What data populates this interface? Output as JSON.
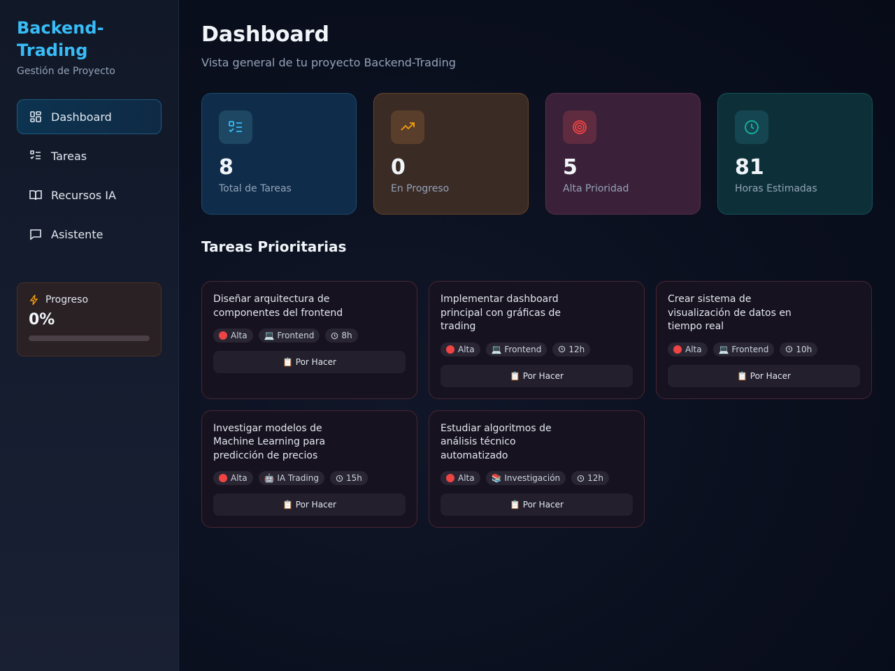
{
  "brand": {
    "title": "Backend-Trading",
    "subtitle": "Gestión de Proyecto"
  },
  "sidebar": {
    "items": [
      {
        "label": "Dashboard",
        "icon": "dashboard-icon",
        "active": true
      },
      {
        "label": "Tareas",
        "icon": "list-check-icon"
      },
      {
        "label": "Recursos IA",
        "icon": "book-icon"
      },
      {
        "label": "Asistente",
        "icon": "chat-icon"
      }
    ],
    "progress": {
      "label": "Progreso",
      "value": "0%",
      "fraction": 0,
      "icon": "bolt-icon"
    }
  },
  "header": {
    "title": "Dashboard",
    "subtitle": "Vista general de tu proyecto Backend-Trading"
  },
  "stats": [
    {
      "value": "8",
      "label": "Total de Tareas",
      "icon": "list-check-icon",
      "color": "#38bdf8"
    },
    {
      "value": "0",
      "label": "En Progreso",
      "icon": "trending-up-icon",
      "color": "#f59e0b"
    },
    {
      "value": "5",
      "label": "Alta Prioridad",
      "icon": "target-icon",
      "color": "#ef4444"
    },
    {
      "value": "81",
      "label": "Horas Estimadas",
      "icon": "clock-icon",
      "color": "#14b8a6"
    }
  ],
  "section_title": "Tareas Prioritarias",
  "tasks": [
    {
      "title": "Diseñar arquitectura de componentes del frontend",
      "priority": "Alta",
      "category": "💻 Frontend",
      "hours": "8h",
      "status": "📋 Por Hacer"
    },
    {
      "title": "Implementar dashboard principal con gráficas de trading",
      "priority": "Alta",
      "category": "💻 Frontend",
      "hours": "12h",
      "status": "📋 Por Hacer"
    },
    {
      "title": "Crear sistema de visualización de datos en tiempo real",
      "priority": "Alta",
      "category": "💻 Frontend",
      "hours": "10h",
      "status": "📋 Por Hacer"
    },
    {
      "title": "Investigar modelos de Machine Learning para predicción de precios",
      "priority": "Alta",
      "category": "🤖 IA Trading",
      "hours": "15h",
      "status": "📋 Por Hacer"
    },
    {
      "title": "Estudiar algoritmos de análisis técnico automatizado",
      "priority": "Alta",
      "category": "📚 Investigación",
      "hours": "12h",
      "status": "📋 Por Hacer"
    }
  ],
  "colors": {
    "accent": "#38bdf8",
    "priority_high": "#ef4444"
  }
}
